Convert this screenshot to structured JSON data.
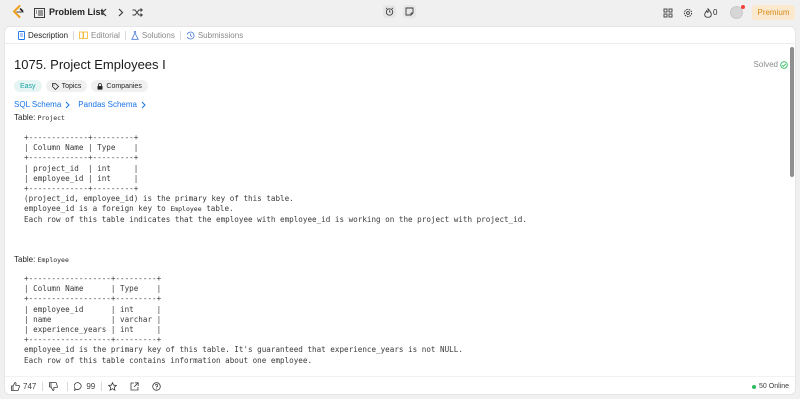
{
  "topbar": {
    "problem_list_label": "Problem List",
    "streak_count": "0",
    "premium_label": "Premium"
  },
  "tabs": [
    {
      "label": "Description"
    },
    {
      "label": "Editorial"
    },
    {
      "label": "Solutions"
    },
    {
      "label": "Submissions"
    }
  ],
  "problem": {
    "title": "1075. Project Employees I",
    "status": "Solved",
    "difficulty": "Easy",
    "topics_label": "Topics",
    "companies_label": "Companies",
    "sql_schema_label": "SQL Schema",
    "pandas_schema_label": "Pandas Schema"
  },
  "project_table": {
    "prefix": "Table: ",
    "name": "Project",
    "ascii": "+-------------+---------+\n| Column Name | Type    |\n+-------------+---------+\n| project_id  | int     |\n| employee_id | int     |\n+-------------+---------+\n(project_id, employee_id) is the primary key of this table.\nemployee_id is a foreign key to ",
    "ascii_fk_table": "Employee",
    "ascii_tail": " table.\nEach row of this table indicates that the employee with employee_id is working on the project with project_id."
  },
  "employee_table": {
    "prefix": "Table: ",
    "name": "Employee",
    "ascii": "+------------------+---------+\n| Column Name      | Type    |\n+------------------+---------+\n| employee_id      | int     |\n| name             | varchar |\n| experience_years | int     |\n+------------------+---------+\nemployee_id is the primary key of this table. It's guaranteed that experience_years is not NULL.\nEach row of this table contains information about one employee."
  },
  "footer": {
    "likes": "747",
    "comments": "99",
    "online": "50 Online"
  },
  "colors": {
    "accent_link": "#1a73e8",
    "easy": "#1aa3a3",
    "solved_check": "#2cbb5d",
    "premium_text": "#d48a1a",
    "premium_bg": "#fbe9cf"
  }
}
